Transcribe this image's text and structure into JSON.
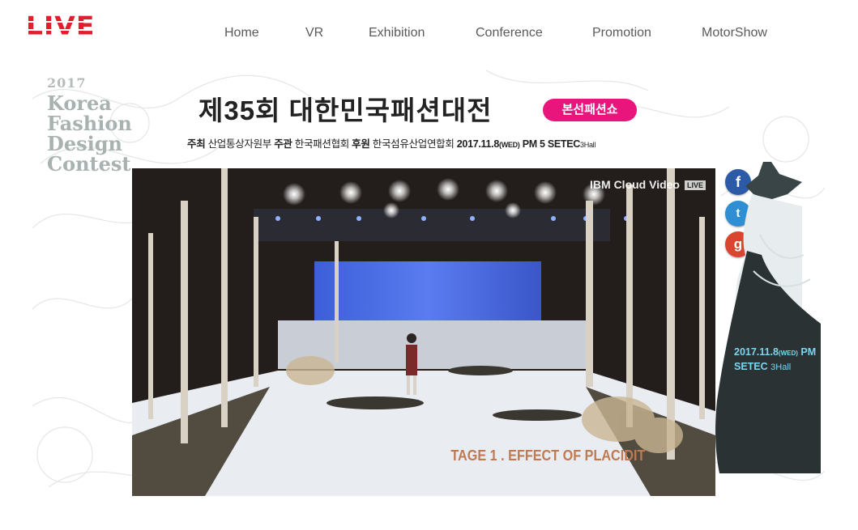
{
  "header": {
    "logo": "LIVE",
    "nav": [
      "Home",
      "VR",
      "Exhibition",
      "Conference",
      "Promotion",
      "MotorShow"
    ]
  },
  "contest": {
    "year": "2017",
    "lines": [
      "Korea",
      "Fashion",
      "Design",
      "Contest"
    ]
  },
  "event": {
    "title": "제35회 대한민국패션대전",
    "badge": "본선패션쇼",
    "host_label": "주최",
    "host": "산업통상자원부",
    "organizer_label": "주관",
    "organizer": "한국패션협회",
    "sponsor_label": "후원",
    "sponsor": "한국섬유산업연합회",
    "date": "2017.11.8",
    "weekday": "(WED)",
    "time": "PM 5",
    "venue": "SETEC",
    "hall": "3Hall"
  },
  "video": {
    "provider": "IBM Cloud Video",
    "live_badge": "LIVE",
    "screen_text": "TAGE 1 . EFFECT OF PLACIDIT"
  },
  "social": {
    "facebook": "f",
    "twitter": "t",
    "google": "g"
  },
  "poster": {
    "date": "2017.11.8",
    "weekday": "(WED)",
    "time": "PM",
    "venue": "SETEC",
    "hall": "3Hall"
  },
  "colors": {
    "brand": "#e11d2e",
    "badge": "#e9157d",
    "facebook": "#2d5aa6",
    "twitter": "#2f8fd2",
    "google": "#d9452e",
    "poster_text": "#79d6ee"
  }
}
